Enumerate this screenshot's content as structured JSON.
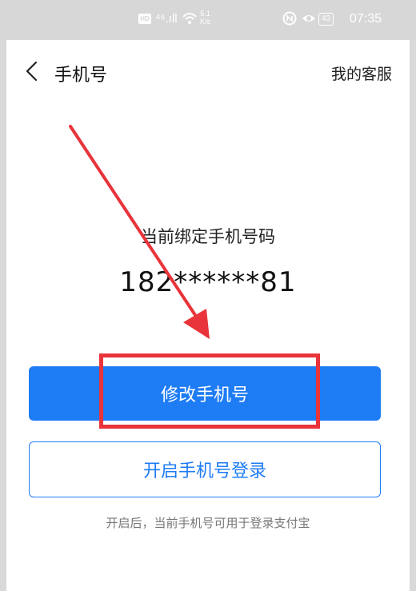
{
  "status_bar": {
    "hd_badge": "HD",
    "signal": "⁴⁶.ıll",
    "speed_value": "5.1",
    "speed_unit": "K/s",
    "battery": "43",
    "time": "07:35"
  },
  "nav": {
    "title": "手机号",
    "service_link": "我的客服"
  },
  "main": {
    "bound_label": "当前绑定手机号码",
    "phone_number": "182******81",
    "change_button": "修改手机号",
    "login_button": "开启手机号登录",
    "hint": "开启后，当前手机号可用于登录支付宝"
  },
  "colors": {
    "accent": "#1e7cf5",
    "annotation": "#e8343a",
    "status_bar_bg": "#d7d7d7"
  }
}
